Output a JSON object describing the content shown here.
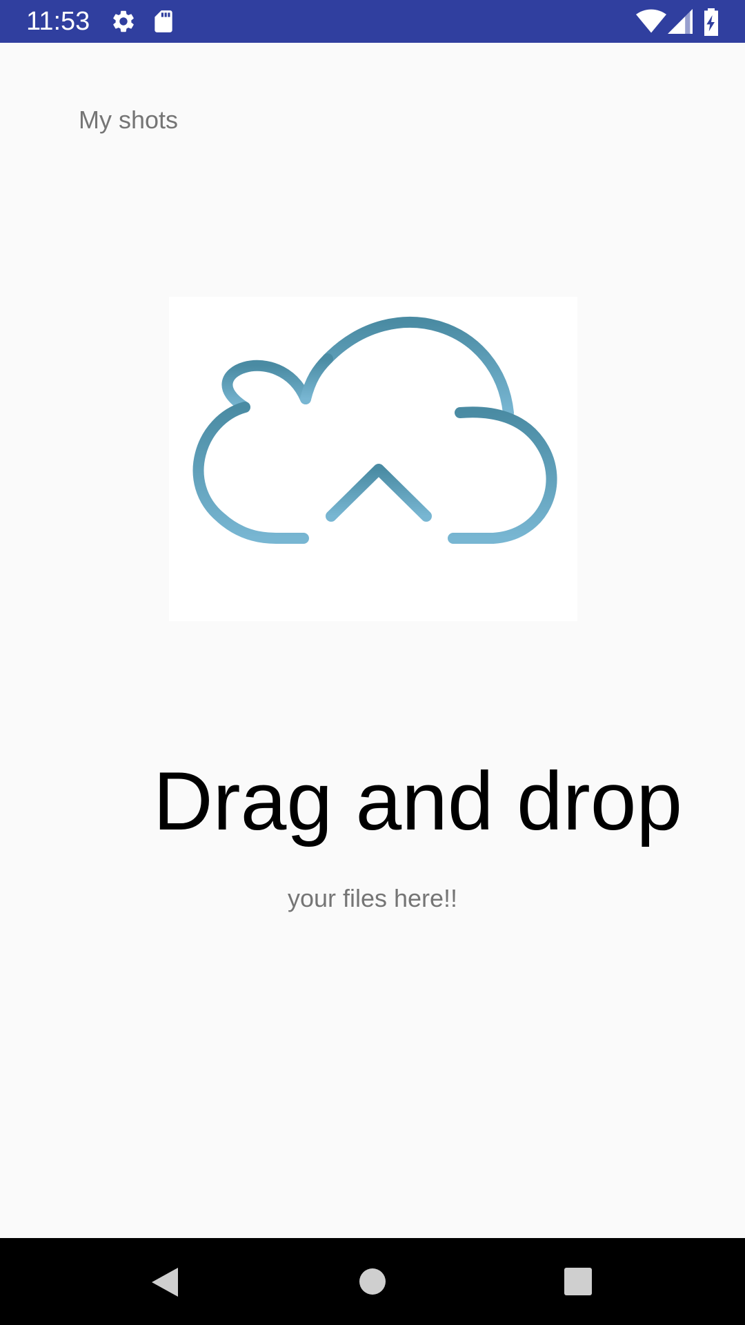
{
  "status_bar": {
    "time": "11:53",
    "background_color": "#303f9f",
    "left_icons": [
      "gear-icon",
      "sd-card-icon"
    ],
    "right_icons": [
      "wifi-icon",
      "signal-icon",
      "battery-charging-icon"
    ]
  },
  "main": {
    "title": "My shots",
    "image_icon": "cloud-upload-icon",
    "headline": "Drag and drop",
    "subtitle": "your files here!!"
  },
  "nav_bar": {
    "buttons": [
      "back-icon",
      "home-icon",
      "recents-icon"
    ]
  },
  "colors": {
    "background": "#fafafa",
    "cloud_top": "#4a8ba3",
    "cloud_bottom": "#78b6d2",
    "muted_text": "#757575"
  }
}
